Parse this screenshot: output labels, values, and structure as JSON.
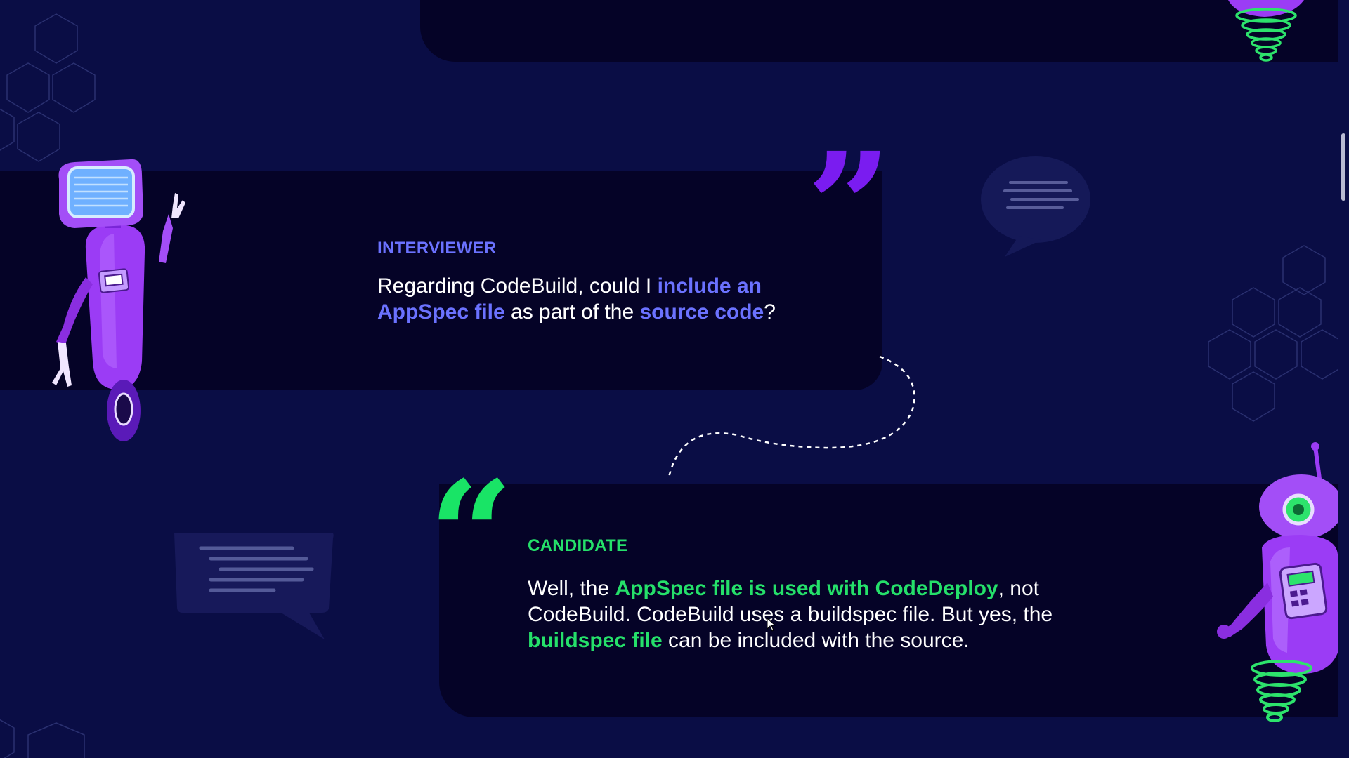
{
  "interviewer": {
    "role": "INTERVIEWER",
    "segments": [
      {
        "text": "Regarding CodeBuild, could I ",
        "highlight": false
      },
      {
        "text": "include an AppSpec file",
        "highlight": true
      },
      {
        "text": " as part of the ",
        "highlight": false
      },
      {
        "text": "source code",
        "highlight": true
      },
      {
        "text": "?",
        "highlight": false
      }
    ],
    "quote_glyph": "”"
  },
  "candidate": {
    "role": "CANDIDATE",
    "segments": [
      {
        "text": "Well, the ",
        "highlight": false
      },
      {
        "text": "AppSpec file is used with CodeDeploy",
        "highlight": true
      },
      {
        "text": ", not CodeBuild. CodeBuild uses a buildspec file. But yes, the ",
        "highlight": false
      },
      {
        "text": "buildspec file",
        "highlight": true
      },
      {
        "text": " can be included with the source.",
        "highlight": false
      }
    ],
    "quote_glyph": "“"
  },
  "colors": {
    "background": "#0a0d45",
    "card": "#050327",
    "interviewer_accent": "#6b72ff",
    "candidate_accent": "#25e06a",
    "robot_purple": "#9b3cf5",
    "text": "#ffffff"
  },
  "decorations": {
    "icons": [
      "robot-interviewer-icon",
      "robot-candidate-icon",
      "robot-top-icon",
      "speech-bubble-icon",
      "hexagon-pattern-icon",
      "dashed-connector-icon",
      "mouse-cursor-icon"
    ]
  }
}
